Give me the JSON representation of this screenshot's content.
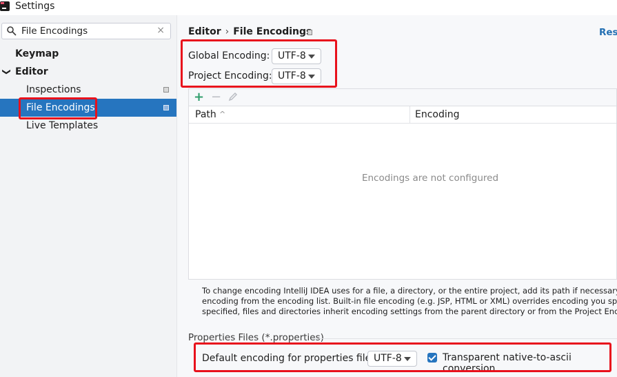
{
  "window": {
    "title": "Settings"
  },
  "sidebar": {
    "search": {
      "value": "File Encodings",
      "clear": "×"
    },
    "items": [
      {
        "label": "Keymap",
        "level": 0,
        "bold": true
      },
      {
        "label": "Editor",
        "level": 0,
        "bold": true,
        "expanded": true,
        "arrow": "❯"
      },
      {
        "label": "Inspections",
        "level": 1
      },
      {
        "label": "File Encodings",
        "level": 1,
        "selected": true
      },
      {
        "label": "Live Templates",
        "level": 1
      }
    ]
  },
  "breadcrumb": {
    "parent": "Editor",
    "separator": "›",
    "current": "File Encodings"
  },
  "header": {
    "reset_label": "Rese"
  },
  "global_encoding": {
    "label": "Global Encoding:",
    "value": "UTF-8"
  },
  "project_encoding": {
    "label": "Project Encoding:",
    "value": "UTF-8"
  },
  "table": {
    "toolbar": {
      "add": "+",
      "remove": "−"
    },
    "columns": [
      "Path",
      "Encoding"
    ],
    "sort_indicator": "^",
    "empty_text": "Encodings are not configured"
  },
  "help_lines": [
    "To change encoding IntelliJ IDEA uses for a file, a directory, or the entire project, add its path if necessary and then",
    "encoding from the encoding list. Built-in file encoding (e.g. JSP, HTML or XML) overrides encoding you specify her",
    "specified, files and directories inherit encoding settings from the parent directory or from the Project Encoding."
  ],
  "properties": {
    "section_title": "Properties Files (*.properties)",
    "default_label": "Default encoding for properties files:",
    "default_value": "UTF-8",
    "transparent_label": "Transparent native-to-ascii conversion",
    "transparent_checked": true
  },
  "colors": {
    "accent": "#2675bf",
    "highlight": "#e8111c",
    "add": "#2f9e6b",
    "link": "#2470b3"
  }
}
